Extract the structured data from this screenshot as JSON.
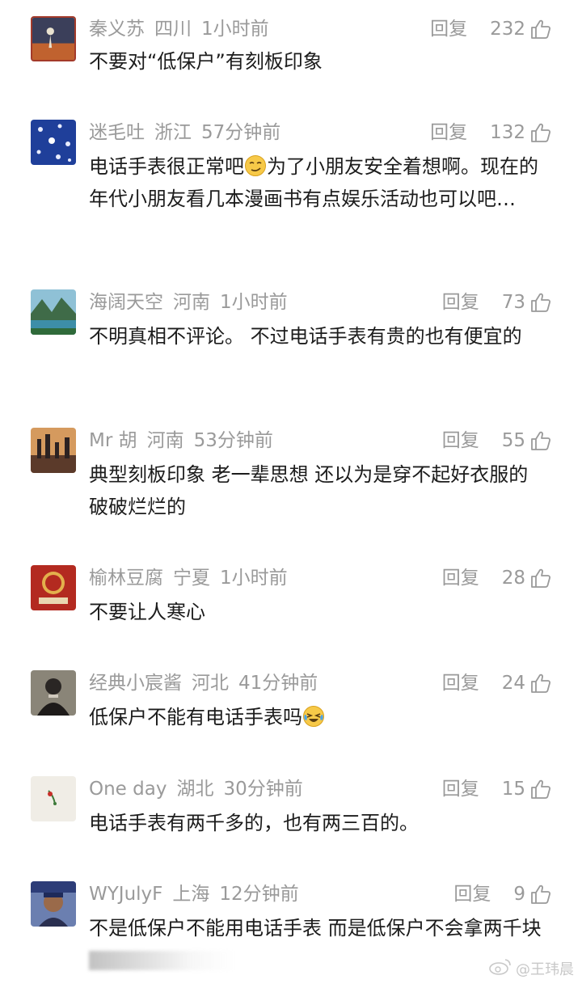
{
  "reply_label": "回复",
  "comments": [
    {
      "user": "秦义苏",
      "region": "四川",
      "time": "1小时前",
      "likes": "232",
      "text": "不要对“低保户”有刻板印象"
    },
    {
      "user": "迷毛吐",
      "region": "浙江",
      "time": "57分钟前",
      "likes": "132",
      "text_before": "电话手表很正常吧",
      "text_after": "为了小朋友安全着想啊。现在的年代小朋友看几本漫画书有点娱乐活动也可以吧…"
    },
    {
      "user": "海阔天空",
      "region": "河南",
      "time": "1小时前",
      "likes": "73",
      "text": "不明真相不评论。 不过电话手表有贵的也有便宜的"
    },
    {
      "user": "Mr 胡",
      "region": "河南",
      "time": "53分钟前",
      "likes": "55",
      "text": "典型刻板印象 老一辈思想 还以为是穿不起好衣服的 破破烂烂的"
    },
    {
      "user": "榆林豆腐",
      "region": "宁夏",
      "time": "1小时前",
      "likes": "28",
      "text": "不要让人寒心"
    },
    {
      "user": "经典小宸酱",
      "region": "河北",
      "time": "41分钟前",
      "likes": "24",
      "text": "低保户不能有电话手表吗"
    },
    {
      "user": "One day",
      "region": "湖北",
      "time": "30分钟前",
      "likes": "15",
      "text": "电话手表有两千多的，也有两三百的。"
    },
    {
      "user": "WYJulyF",
      "region": "上海",
      "time": "12分钟前",
      "likes": "9",
      "text": "不是低保户不能用电话手表 而是低保户不会拿两千块"
    }
  ],
  "watermark": "@王玮晨",
  "colors": {
    "meta": "#9a9a9a",
    "text": "#1c1c1c",
    "background": "#ffffff"
  },
  "icons": {
    "like": "thumbs-up-icon",
    "watermark": "weibo-logo-icon"
  }
}
